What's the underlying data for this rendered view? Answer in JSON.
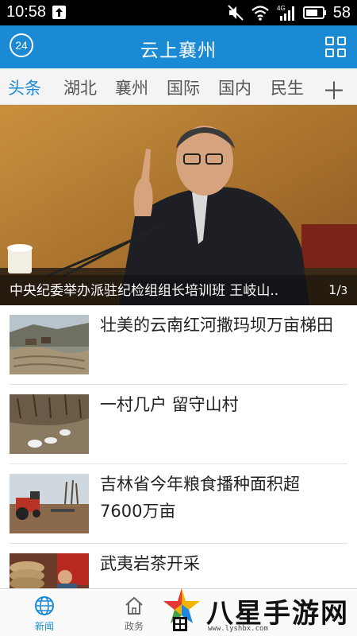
{
  "status_bar": {
    "time": "10:58",
    "battery": "58",
    "network": "4G"
  },
  "header": {
    "badge": "24",
    "title": "云上襄州",
    "grid_icon": "grid-icon"
  },
  "tabs": [
    {
      "label": "头条",
      "active": true
    },
    {
      "label": "湖北"
    },
    {
      "label": "襄州"
    },
    {
      "label": "国际"
    },
    {
      "label": "国内"
    },
    {
      "label": "民生"
    }
  ],
  "tabs_add": "＋",
  "hero": {
    "caption": "中央纪委举办派驻纪检组组长培训班 王岐山..",
    "page_current": "1",
    "page_sep": "/",
    "page_total": "3"
  },
  "news": [
    {
      "title": "壮美的云南红河撒玛坝万亩梯田"
    },
    {
      "title": "一村几户 留守山村"
    },
    {
      "title": "吉林省今年粮食播种面积超7600万亩"
    },
    {
      "title": "武夷岩茶开采"
    }
  ],
  "bottom_nav": [
    {
      "label": "新闻",
      "icon": "globe-icon",
      "active": true
    },
    {
      "label": "政务",
      "icon": "home-icon"
    }
  ],
  "watermark": {
    "text": "八星手游网",
    "url": "www.lyshbx.com"
  },
  "colors": {
    "primary": "#1a8ad4",
    "tab_bg": "#f4f4f4",
    "text": "#222222"
  }
}
